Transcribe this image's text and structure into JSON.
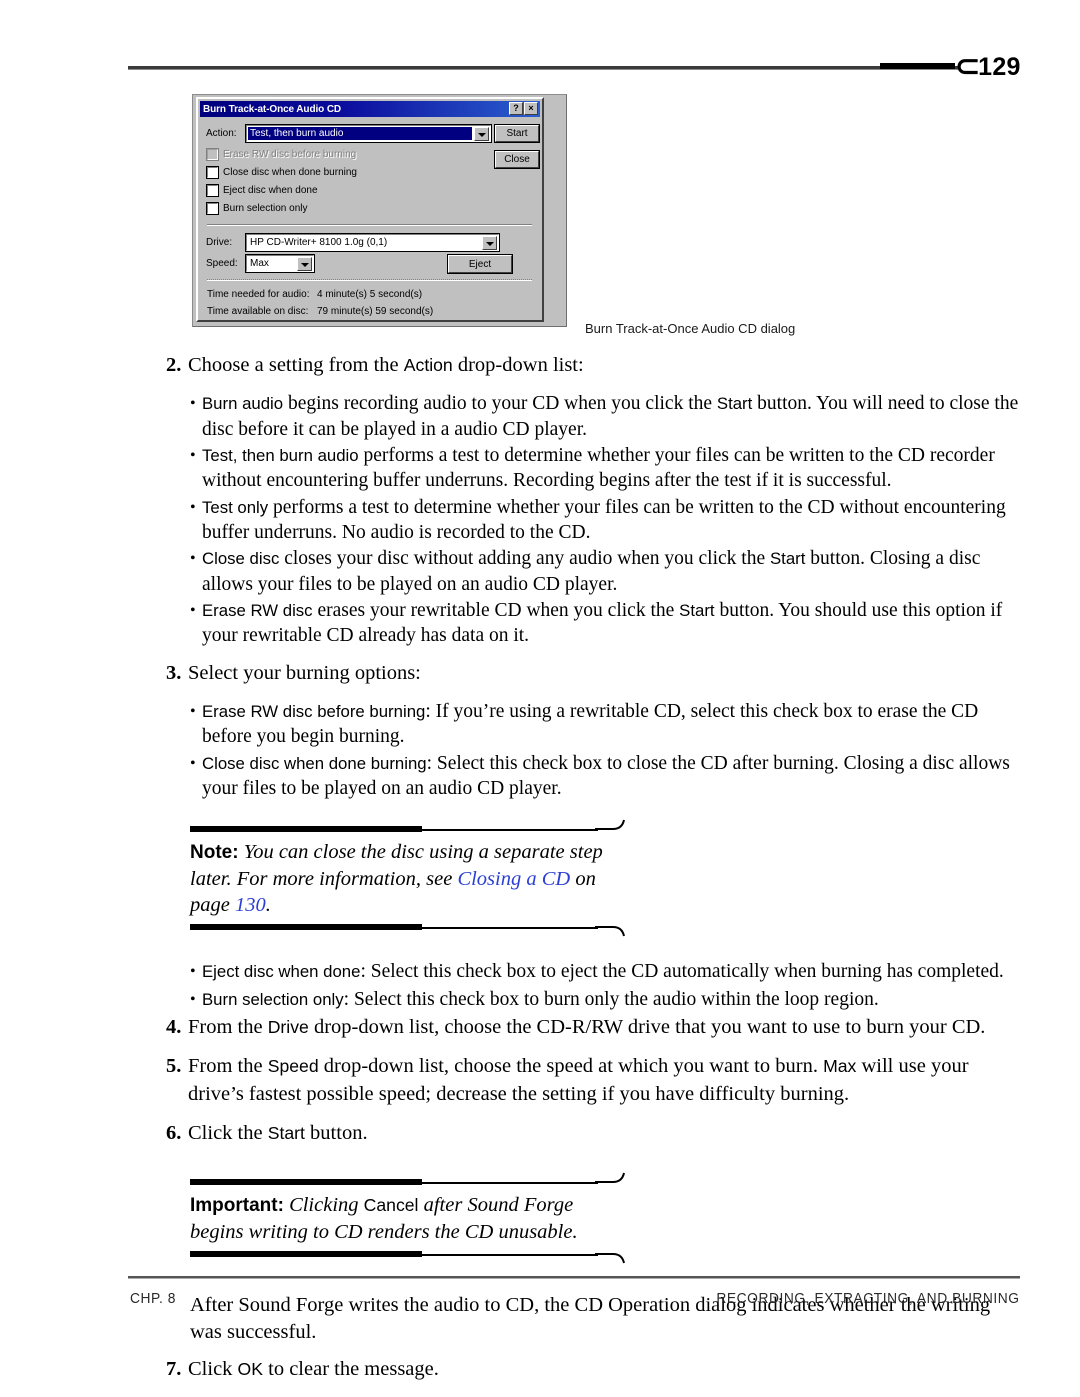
{
  "header": {
    "page_number": "129",
    "bracket_glyph": "⊂"
  },
  "figure": {
    "caption": "Burn Track-at-Once Audio CD dialog",
    "dialog": {
      "title": "Burn Track-at-Once Audio CD",
      "help_button": "?",
      "close_button": "×",
      "action_label": "Action:",
      "action_value": "Test, then burn audio",
      "start_button": "Start",
      "close_btn": "Close",
      "checkboxes": [
        {
          "label": "Erase RW disc before burning",
          "checked": false,
          "disabled": true
        },
        {
          "label": "Close disc when done burning",
          "checked": false,
          "disabled": false
        },
        {
          "label": "Eject disc when done",
          "checked": false,
          "disabled": false
        },
        {
          "label": "Burn selection only",
          "checked": false,
          "disabled": false
        }
      ],
      "drive_label": "Drive:",
      "drive_value": "HP CD-Writer+ 8100 1.0g (0,1)",
      "speed_label": "Speed:",
      "speed_value": "Max",
      "eject_button": "Eject",
      "time_needed_label": "Time needed for audio:",
      "time_needed_value": "4 minute(s) 5 second(s)",
      "time_available_label": "Time available on disc:",
      "time_available_value": "79 minute(s) 59 second(s)"
    }
  },
  "content": {
    "step2": {
      "num": "2.",
      "text_a": "Choose a setting from the ",
      "ui_action": "Action",
      "text_b": " drop-down list:"
    },
    "step2_bullets": [
      {
        "ui_lead": "Burn audio",
        "text_a": " begins recording audio to your CD when you click the ",
        "ui_mid": "Start",
        "text_b": " button. You will need to close the disc before it can be played in a audio CD player."
      },
      {
        "ui_lead": "Test, then burn audio",
        "text_a": " performs a test to determine whether your files can be written to the CD recorder without encountering buffer underruns. Recording begins after the test if it is successful.",
        "ui_mid": "",
        "text_b": ""
      },
      {
        "ui_lead": "Test only",
        "text_a": " performs a test to determine whether your files can be written to the CD without encountering buffer underruns. No audio is recorded to the CD.",
        "ui_mid": "",
        "text_b": ""
      },
      {
        "ui_lead": "Close disc",
        "text_a": " closes your disc without adding any audio when you click the ",
        "ui_mid": "Start",
        "text_b": " button. Closing a disc allows your files to be played on an audio CD player."
      },
      {
        "ui_lead": "Erase RW disc",
        "text_a": " erases your rewritable CD when you click the ",
        "ui_mid": "Start",
        "text_b": " button. You should use this option if your rewritable CD already has data on it."
      }
    ],
    "step3": {
      "num": "3.",
      "text_a": "Select your burning options:"
    },
    "step3_bullets_top": [
      {
        "ui_lead": "Erase RW disc before burning",
        "text_a": ": If you’re using a rewritable CD, select this check box to erase the CD before you begin burning."
      },
      {
        "ui_lead": "Close disc when done burning",
        "text_a": ": Select this check box to close the CD after burning. Closing a disc allows your files to be played on an audio CD player."
      }
    ],
    "note_callout": {
      "keyword": "Note:",
      "text_a": " You can close the disc using a separate step later. For more information, see ",
      "link_a": "Closing a CD",
      "text_b": " on page ",
      "link_b": "130",
      "text_c": "."
    },
    "step3_bullets_bottom": [
      {
        "ui_lead": "Eject disc when done",
        "text_a": ": Select this check box to eject the CD automatically when burning has completed."
      },
      {
        "ui_lead": "Burn selection only",
        "text_a": ": Select this check box to burn only the audio within the loop region."
      }
    ],
    "step4": {
      "num": "4.",
      "text_a": "From the ",
      "ui_a": "Drive",
      "text_b": " drop-down list, choose the CD-R/RW drive that you want to use to burn your CD."
    },
    "step5": {
      "num": "5.",
      "text_a": "From the ",
      "ui_a": "Speed",
      "text_b": " drop-down list, choose the speed at which you want to burn. ",
      "ui_b": "Max",
      "text_c": " will use your drive’s fastest possible speed; decrease the setting if you have difficulty burning."
    },
    "step6": {
      "num": "6.",
      "text_a": "Click the ",
      "ui_a": "Start",
      "text_b": " button."
    },
    "important_callout": {
      "keyword": "Important:",
      "text_a": " Clicking ",
      "ui_a": "Cancel",
      "text_b": " after Sound Forge begins writing to CD renders the CD unusable."
    },
    "result_para": {
      "text": "After Sound Forge writes the audio to CD, the CD Operation dialog indicates whether the writing was successful."
    },
    "step7": {
      "num": "7.",
      "text_a": "Click ",
      "ui_a": "OK",
      "text_b": " to clear the message."
    }
  },
  "footer": {
    "left": "CHP. 8",
    "right": "RECORDING, EXTRACTING, AND BURNING"
  }
}
